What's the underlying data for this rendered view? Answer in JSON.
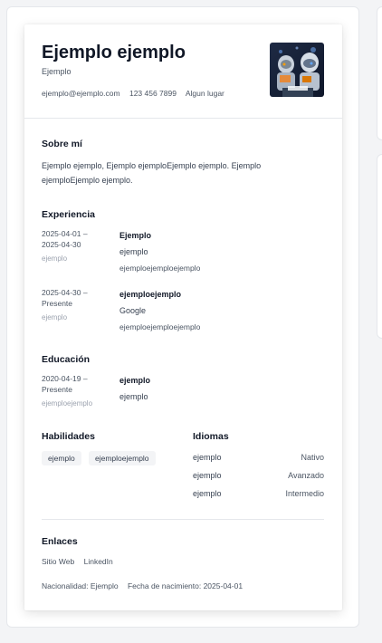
{
  "profile": {
    "name": "Ejemplo ejemplo",
    "role": "Ejemplo",
    "email": "ejemplo@ejemplo.com",
    "phone": "123 456 7899",
    "location": "Algun lugar"
  },
  "about": {
    "title": "Sobre mí",
    "text": "Ejemplo ejemplo, Ejemplo ejemploEjemplo ejemplo. Ejemplo ejemploEjemplo ejemplo."
  },
  "experience": {
    "title": "Experiencia",
    "items": [
      {
        "date_start": "2025-04-01 –",
        "date_end": "2025-04-30",
        "location": "ejemplo",
        "position": "Ejemplo",
        "company": "ejemplo",
        "description": "ejemploejemploejemplo"
      },
      {
        "date_start": "2025-04-30 –",
        "date_end": "Presente",
        "location": "ejemplo",
        "position": "ejemploejemplo",
        "company": "Google",
        "description": "ejemploejemploejemplo"
      }
    ]
  },
  "education": {
    "title": "Educación",
    "items": [
      {
        "date_start": "2020-04-19 –",
        "date_end": "Presente",
        "location": "ejemploejemplo",
        "degree": "ejemplo",
        "school": "ejemplo"
      }
    ]
  },
  "skills": {
    "title": "Habilidades",
    "items": [
      "ejemplo",
      "ejemploejemplo"
    ]
  },
  "languages": {
    "title": "Idiomas",
    "items": [
      {
        "name": "ejemplo",
        "level": "Nativo"
      },
      {
        "name": "ejemplo",
        "level": "Avanzado"
      },
      {
        "name": "ejemplo",
        "level": "Intermedio"
      }
    ]
  },
  "links": {
    "title": "Enlaces",
    "items": [
      "Sitio Web",
      "LinkedIn"
    ]
  },
  "footer": {
    "nationality": "Nacionalidad: Ejemplo",
    "birthdate": "Fecha de nacimiento: 2025-04-01"
  }
}
